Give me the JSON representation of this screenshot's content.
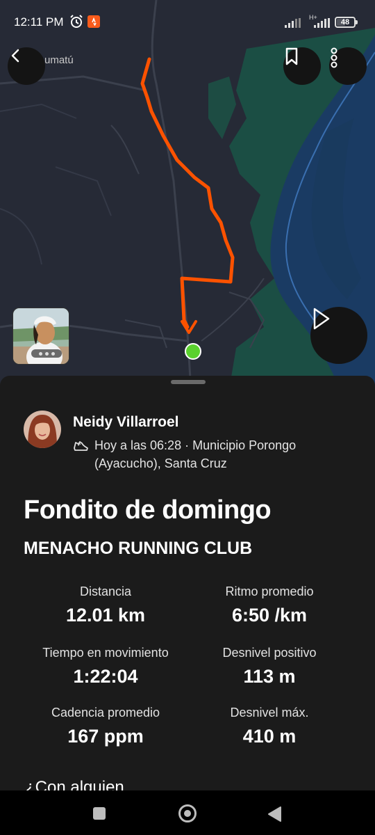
{
  "status_bar": {
    "time": "12:11 PM",
    "network_label": "H+",
    "battery": "48"
  },
  "map": {
    "place_label": "umatú",
    "accent_color": "#fc5200",
    "start_color": "#5ad12e"
  },
  "header_actions": {
    "back_icon": "chevron-left-icon",
    "bookmark_icon": "bookmark-icon",
    "more_icon": "more-vertical-icon",
    "play_icon": "play-icon"
  },
  "activity": {
    "athlete_name": "Neidy Villarroel",
    "meta": "Hoy a las 06:28 · Municipio Porongo (Ayacucho), Santa Cruz",
    "title": "Fondito de domingo",
    "club": "MENACHO RUNNING CLUB",
    "stats": [
      {
        "label": "Distancia",
        "value": "12.01 km"
      },
      {
        "label": "Ritmo promedio",
        "value": "6:50 /km"
      },
      {
        "label": "Tiempo en movimiento",
        "value": "1:22:04"
      },
      {
        "label": "Desnivel positivo",
        "value": "113 m"
      },
      {
        "label": "Cadencia promedio",
        "value": "167 ppm"
      },
      {
        "label": "Desnivel máx.",
        "value": "410 m"
      }
    ],
    "with_someone": "¿Con alguien"
  }
}
